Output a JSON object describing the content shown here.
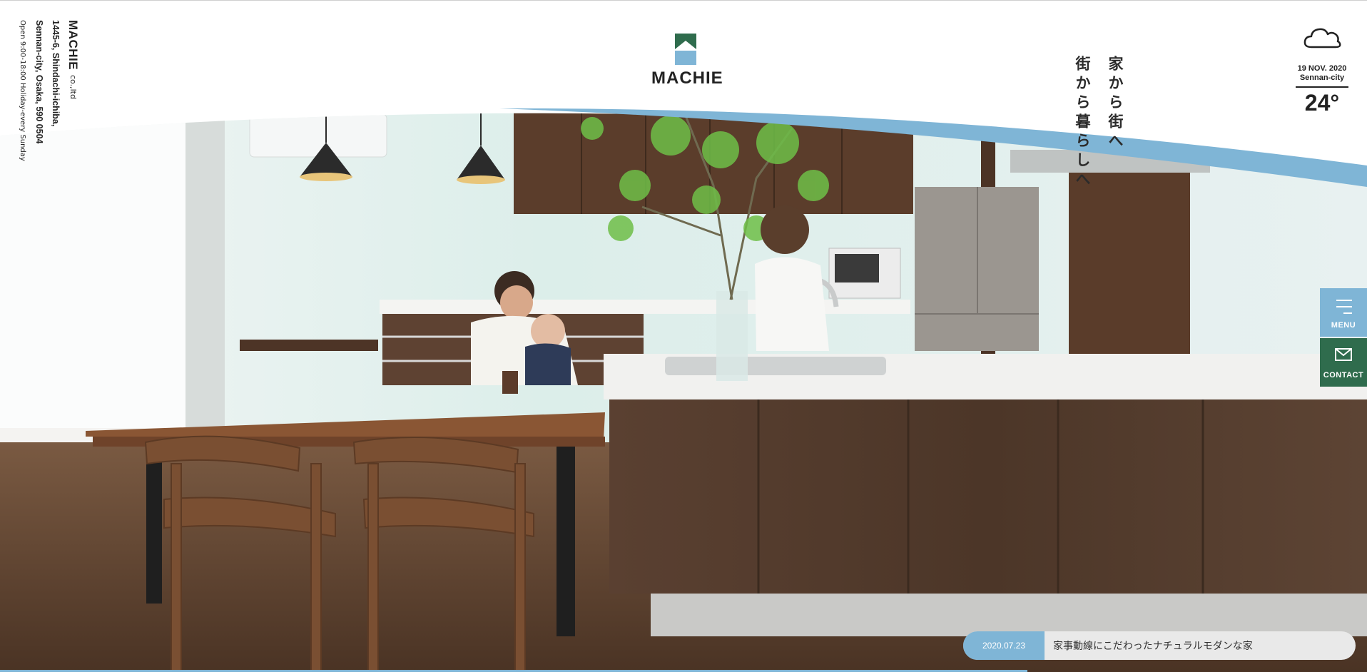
{
  "company": {
    "name": "MACHIE",
    "suffix": "co.,ltd",
    "address_line1": "1445-6, Shindachi-ichiba,",
    "address_line2": "Sennan-city, Osaka, 590 0504",
    "hours": "Open 9:00-18:00   Holiday-every Sunday"
  },
  "logo": {
    "text": "MACHIE"
  },
  "tagline": [
    "家から街へ",
    "街から暮らしへ"
  ],
  "weather": {
    "icon": "cloud-icon",
    "date": "19 NOV. 2020",
    "city": "Sennan-city",
    "temperature": "24°"
  },
  "side": {
    "menu_label": "MENU",
    "contact_label": "CONTACT"
  },
  "news": {
    "date": "2020.07.23",
    "title": "家事動線にこだわったナチュラルモダンな家"
  },
  "colors": {
    "accent_blue": "#7fb5d6",
    "brand_green": "#2f6c4d"
  }
}
